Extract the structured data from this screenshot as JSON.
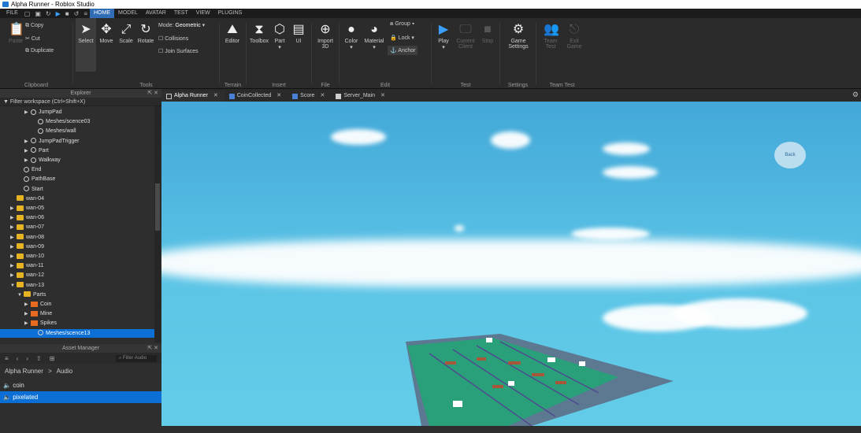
{
  "window": {
    "title": "Alpha Runner - Roblox Studio"
  },
  "menubar": {
    "file": "FILE",
    "tabs": [
      "HOME",
      "MODEL",
      "AVATAR",
      "TEST",
      "VIEW",
      "PLUGINS"
    ],
    "active_tab": "HOME"
  },
  "ribbon": {
    "clipboard": {
      "label": "Clipboard",
      "paste": "Paste",
      "copy": "Copy",
      "cut": "Cut",
      "duplicate": "Duplicate"
    },
    "tools": {
      "label": "Tools",
      "select": "Select",
      "move": "Move",
      "scale": "Scale",
      "rotate": "Rotate",
      "mode_label": "Mode:",
      "mode_value": "Geometric",
      "collisions": "Collisions",
      "join_surfaces": "Join Surfaces"
    },
    "terrain": {
      "label": "Terrain",
      "editor": "Editor"
    },
    "insert": {
      "label": "Insert",
      "toolbox": "Toolbox",
      "part": "Part",
      "ui": "UI"
    },
    "file": {
      "label": "File",
      "import_3d": "Import 3D"
    },
    "edit": {
      "label": "Edit",
      "color": "Color",
      "material": "Material",
      "group": "Group",
      "lock": "Lock",
      "anchor": "Anchor"
    },
    "test": {
      "label": "Test",
      "play": "Play",
      "current_client": "Current Client",
      "stop": "Stop"
    },
    "settings": {
      "label": "Settings",
      "game_settings": "Game Settings"
    },
    "team_test": {
      "label": "Team Test",
      "team_test": "Team Test",
      "exit_game": "Exit Game"
    }
  },
  "explorer": {
    "title": "Explorer",
    "filter_placeholder": "Filter workspace (Ctrl+Shift+X)",
    "items": [
      {
        "label": "JumpPad",
        "indent": 3,
        "icon": "model",
        "arrow": true
      },
      {
        "label": "Meshes/scence03",
        "indent": 4,
        "icon": "mesh",
        "arrow": false
      },
      {
        "label": "Meshes/wall",
        "indent": 4,
        "icon": "mesh",
        "arrow": false
      },
      {
        "label": "JumpPadTrigger",
        "indent": 3,
        "icon": "model",
        "arrow": true
      },
      {
        "label": "Part",
        "indent": 3,
        "icon": "model",
        "arrow": true
      },
      {
        "label": "Walkway",
        "indent": 3,
        "icon": "model",
        "arrow": true
      },
      {
        "label": "End",
        "indent": 2,
        "icon": "model",
        "arrow": false
      },
      {
        "label": "PathBase",
        "indent": 2,
        "icon": "model",
        "arrow": false
      },
      {
        "label": "Start",
        "indent": 2,
        "icon": "model",
        "arrow": false
      },
      {
        "label": "wan-04",
        "indent": 1,
        "icon": "folder",
        "arrow": false
      },
      {
        "label": "wan-05",
        "indent": 1,
        "icon": "folder",
        "arrow": true
      },
      {
        "label": "wan-06",
        "indent": 1,
        "icon": "folder",
        "arrow": true
      },
      {
        "label": "wan-07",
        "indent": 1,
        "icon": "folder",
        "arrow": true
      },
      {
        "label": "wan-08",
        "indent": 1,
        "icon": "folder",
        "arrow": true
      },
      {
        "label": "wan-09",
        "indent": 1,
        "icon": "folder",
        "arrow": true
      },
      {
        "label": "wan-10",
        "indent": 1,
        "icon": "folder",
        "arrow": true
      },
      {
        "label": "wan-11",
        "indent": 1,
        "icon": "folder",
        "arrow": true
      },
      {
        "label": "wan-12",
        "indent": 1,
        "icon": "folder",
        "arrow": true
      },
      {
        "label": "wan-13",
        "indent": 1,
        "icon": "folder",
        "arrow": true,
        "expanded": true
      },
      {
        "label": "Parts",
        "indent": 2,
        "icon": "folder",
        "arrow": true,
        "expanded": true
      },
      {
        "label": "Coin",
        "indent": 3,
        "icon": "part",
        "arrow": true
      },
      {
        "label": "Mine",
        "indent": 3,
        "icon": "part",
        "arrow": true
      },
      {
        "label": "Spikes",
        "indent": 3,
        "icon": "part",
        "arrow": true
      },
      {
        "label": "Meshes/scence13",
        "indent": 4,
        "icon": "mesh",
        "arrow": false,
        "selected": true
      }
    ]
  },
  "asset_manager": {
    "title": "Asset Manager",
    "search_placeholder": "Filter Audio",
    "breadcrumb_root": "Alpha Runner",
    "breadcrumb_sep": ">",
    "breadcrumb_leaf": "Audio",
    "items": [
      {
        "label": "coin",
        "selected": false
      },
      {
        "label": "pixelated",
        "selected": true
      }
    ]
  },
  "editor_tabs": [
    {
      "label": "Alpha Runner",
      "active": true,
      "color": "#cfcfcf"
    },
    {
      "label": "CoinCollected",
      "active": false,
      "color": "#4a7fd8"
    },
    {
      "label": "Score",
      "active": false,
      "color": "#4a7fd8"
    },
    {
      "label": "Server_Main",
      "active": false,
      "color": "#cfcfcf"
    }
  ],
  "viewport": {
    "back_label": "Back"
  },
  "colors": {
    "accent": "#0b6fd6",
    "sky_top": "#43a8d8",
    "sky_bottom": "#63cde8"
  }
}
